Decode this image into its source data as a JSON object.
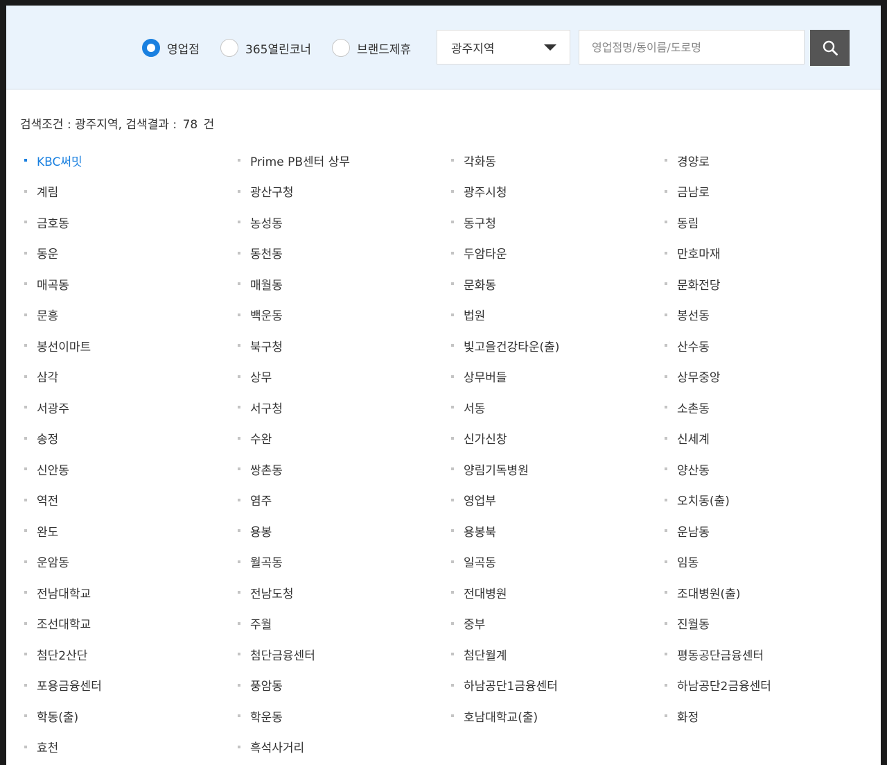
{
  "search": {
    "radio_options": [
      {
        "label": "영업점",
        "selected": true
      },
      {
        "label": "365열린코너",
        "selected": false
      },
      {
        "label": "브랜드제휴",
        "selected": false
      }
    ],
    "region_select": "광주지역",
    "input_placeholder": "영업점명/동이름/도로명",
    "button_icon": "search-icon"
  },
  "result": {
    "prefix": "검색조건 : 광주지역, 검색결과 :",
    "count": "78",
    "unit": "건"
  },
  "branches": [
    "KBC써밋",
    "Prime PB센터 상무",
    "각화동",
    "경양로",
    "계림",
    "광산구청",
    "광주시청",
    "금남로",
    "금호동",
    "농성동",
    "동구청",
    "동림",
    "동운",
    "동천동",
    "두암타운",
    "만호마재",
    "매곡동",
    "매월동",
    "문화동",
    "문화전당",
    "문흥",
    "백운동",
    "법원",
    "봉선동",
    "봉선이마트",
    "북구청",
    "빛고을건강타운(출)",
    "산수동",
    "삼각",
    "상무",
    "상무버들",
    "상무중앙",
    "서광주",
    "서구청",
    "서동",
    "소촌동",
    "송정",
    "수완",
    "신가신창",
    "신세계",
    "신안동",
    "쌍촌동",
    "양림기독병원",
    "양산동",
    "역전",
    "염주",
    "영업부",
    "오치동(출)",
    "완도",
    "용봉",
    "용봉북",
    "운남동",
    "운암동",
    "월곡동",
    "일곡동",
    "임동",
    "전남대학교",
    "전남도청",
    "전대병원",
    "조대병원(출)",
    "조선대학교",
    "주월",
    "중부",
    "진월동",
    "첨단2산단",
    "첨단금융센터",
    "첨단월계",
    "평동공단금융센터",
    "포용금융센터",
    "풍암동",
    "하남공단1금융센터",
    "하남공단2금융센터",
    "학동(출)",
    "학운동",
    "호남대학교(출)",
    "화정",
    "효천",
    "흑석사거리"
  ],
  "active_branch_index": 0,
  "colors": {
    "accent": "#1a80e0",
    "search_bar_bg": "#eaf3fc",
    "search_button": "#555555"
  }
}
